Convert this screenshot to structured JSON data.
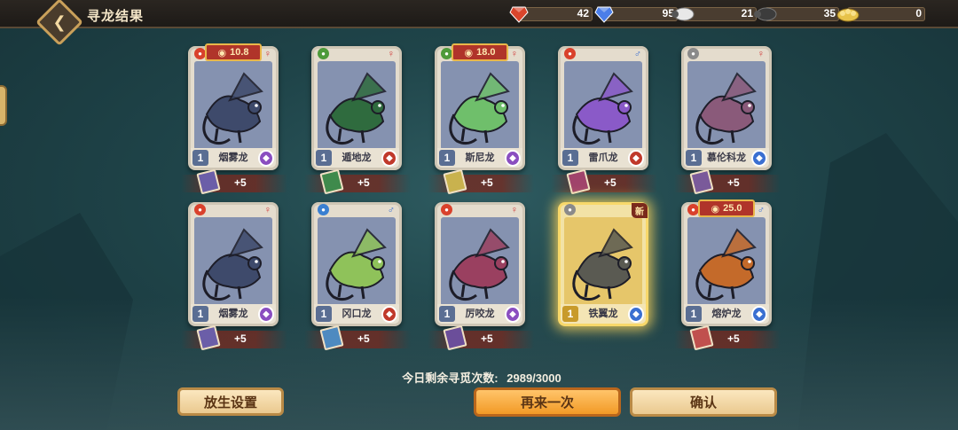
{
  "header": {
    "title": "寻龙结果",
    "back_icon": "back-arrow-icon"
  },
  "resources": [
    {
      "name": "ruby",
      "icon": "ruby-icon",
      "value": "42",
      "color": "#d9452c"
    },
    {
      "name": "sapphire",
      "icon": "sapphire-icon",
      "value": "95",
      "color": "#4b7ee8"
    },
    {
      "name": "sheep",
      "icon": "sheep-icon",
      "value": "21",
      "color": "#e8e8e8"
    },
    {
      "name": "black-sheep",
      "icon": "black-sheep-icon",
      "value": "35",
      "color": "#3c3c3c"
    },
    {
      "name": "golden-fleece",
      "icon": "golden-fleece-icon",
      "value": "0",
      "color": "#e7c24a"
    }
  ],
  "cards": [
    {
      "name": "烟雾龙",
      "level": "1",
      "gender": "♀",
      "gender_color": "#d13a3a",
      "element_color": "#d9412c",
      "class_color": "#8a4ec0",
      "art_color": "#8592b0",
      "dragon_color": "#3e4a6b",
      "price": "10.8",
      "reward": "+5",
      "scroll_color": "#6b5ea8"
    },
    {
      "name": "遁地龙",
      "level": "1",
      "gender": "♀",
      "gender_color": "#d13a3a",
      "element_color": "#4e9a3a",
      "class_color": "#c0392b",
      "art_color": "#8592b0",
      "dragon_color": "#2f6b3e",
      "reward": "+5",
      "scroll_color": "#3f8a4c"
    },
    {
      "name": "斯尼龙",
      "level": "1",
      "gender": "♀",
      "gender_color": "#d13a3a",
      "element_color": "#4e9a3a",
      "class_color": "#8a4ec0",
      "art_color": "#8592b0",
      "dragon_color": "#6fbf6b",
      "price": "18.0",
      "reward": "+5",
      "scroll_color": "#c9b24e"
    },
    {
      "name": "雷爪龙",
      "level": "1",
      "gender": "♂",
      "gender_color": "#3a6fd1",
      "element_color": "#d9412c",
      "class_color": "#c0392b",
      "art_color": "#8592b0",
      "dragon_color": "#8a5ac8",
      "reward": "+5",
      "scroll_color": "#a0436b"
    },
    {
      "name": "慕伦科龙",
      "level": "1",
      "gender": "♀",
      "gender_color": "#d13a3a",
      "element_color": "#8a8a8a",
      "class_color": "#3a6fd1",
      "art_color": "#8592b0",
      "dragon_color": "#8a5a7a",
      "reward": "+5",
      "scroll_color": "#7a5a9a"
    },
    {
      "name": "烟雾龙",
      "level": "1",
      "gender": "♀",
      "gender_color": "#d13a3a",
      "element_color": "#d9412c",
      "class_color": "#8a4ec0",
      "art_color": "#8592b0",
      "dragon_color": "#3e4a6b",
      "reward": "+5",
      "scroll_color": "#6b5ea8"
    },
    {
      "name": "冈口龙",
      "level": "1",
      "gender": "♂",
      "gender_color": "#3a6fd1",
      "element_color": "#3a7fd1",
      "class_color": "#c0392b",
      "art_color": "#8592b0",
      "dragon_color": "#8fc25a",
      "reward": "+5",
      "scroll_color": "#4e8ac0"
    },
    {
      "name": "厉咬龙",
      "level": "1",
      "gender": "♀",
      "gender_color": "#d13a3a",
      "element_color": "#d9412c",
      "class_color": "#8a4ec0",
      "art_color": "#8592b0",
      "dragon_color": "#9a4060",
      "reward": "+5",
      "scroll_color": "#6b4e9a"
    },
    {
      "name": "铁翼龙",
      "level": "1",
      "gender": "♂",
      "gender_color": "#3a6fd1",
      "element_color": "#8a8a8a",
      "class_color": "#3a6fd1",
      "art_color": "#e6c66a",
      "dragon_color": "#5a5a52",
      "badge": "新",
      "highlight": true
    },
    {
      "name": "熔炉龙",
      "level": "1",
      "gender": "♂",
      "gender_color": "#3a6fd1",
      "element_color": "#d9412c",
      "class_color": "#3a6fd1",
      "art_color": "#8592b0",
      "dragon_color": "#c46a2a",
      "price": "25.0",
      "reward": "+5",
      "scroll_color": "#c0504e"
    }
  ],
  "remaining": {
    "label": "今日剩余寻觅次数:",
    "value": "2989/3000"
  },
  "buttons": {
    "release": "放生设置",
    "again": "再来一次",
    "confirm": "确认"
  }
}
